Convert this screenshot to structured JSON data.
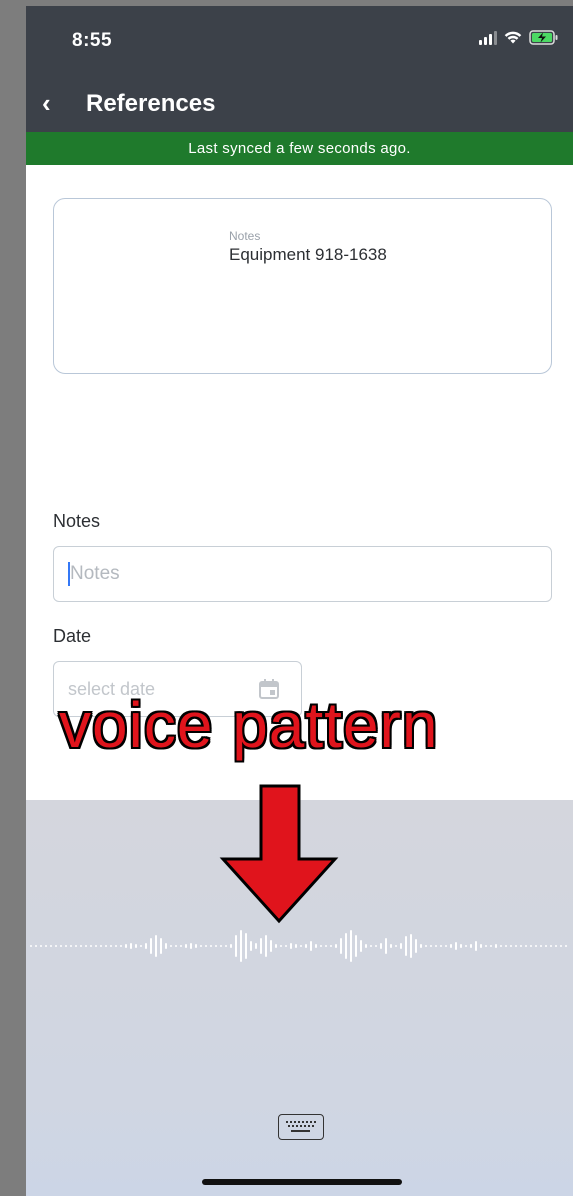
{
  "status_bar": {
    "time": "8:55"
  },
  "header": {
    "title": "References",
    "back_glyph": "‹"
  },
  "sync_banner": {
    "text": "Last synced a few seconds ago."
  },
  "card": {
    "label": "Notes",
    "value": "Equipment 918-1638"
  },
  "form": {
    "notes_label": "Notes",
    "notes_placeholder": "Notes",
    "date_label": "Date",
    "date_placeholder": "select date"
  },
  "annotation": {
    "text": "voice pattern",
    "color": "#e0141c"
  },
  "colors": {
    "header_bg": "#3c4149",
    "banner_bg": "#1f7a2c",
    "caret": "#3478f6"
  },
  "icons": [
    "back-chevron-icon",
    "signal-icon",
    "wifi-icon",
    "battery-charging-icon",
    "calendar-icon",
    "keyboard-icon"
  ]
}
